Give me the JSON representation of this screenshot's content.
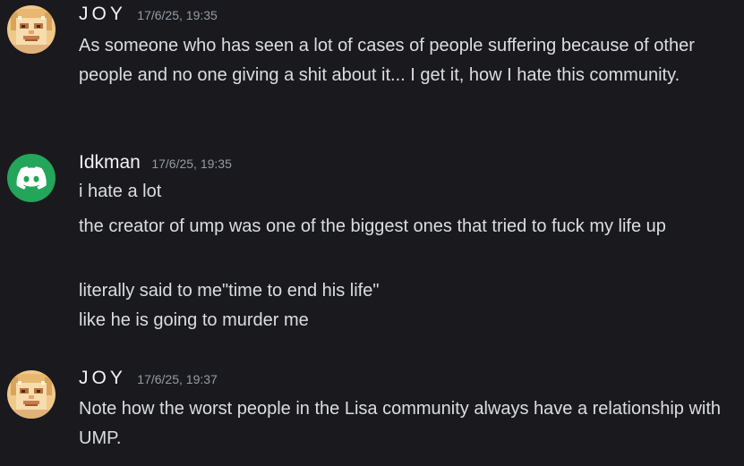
{
  "messages": [
    {
      "username": "JOY",
      "timestamp": "17/6/25, 19:35",
      "lines": [
        "As someone who has seen a lot of cases of people suffering because of other people and no one giving a shit about it... I get it, how I hate this community."
      ]
    },
    {
      "username": "Idkman",
      "timestamp": "17/6/25, 19:35",
      "lines": [
        "i hate a lot",
        "the creator of ump was one of the biggest ones that tried to fuck my life up",
        "literally said to me\"time to end his life\"",
        "like he is going to murder me"
      ]
    },
    {
      "username": "JOY",
      "timestamp": "17/6/25, 19:37",
      "lines": [
        "Note how the worst people in the Lisa community always have a relationship with UMP."
      ]
    }
  ],
  "colors": {
    "background": "#1a1a1e",
    "username": "#f2f3f5",
    "timestamp": "#949ba4",
    "message_text": "#dbdee1",
    "discord_avatar": "#23a55a"
  },
  "icons": {
    "joy_avatar": "pixel-art-face-icon",
    "idkman_avatar": "discord-logo-icon"
  }
}
